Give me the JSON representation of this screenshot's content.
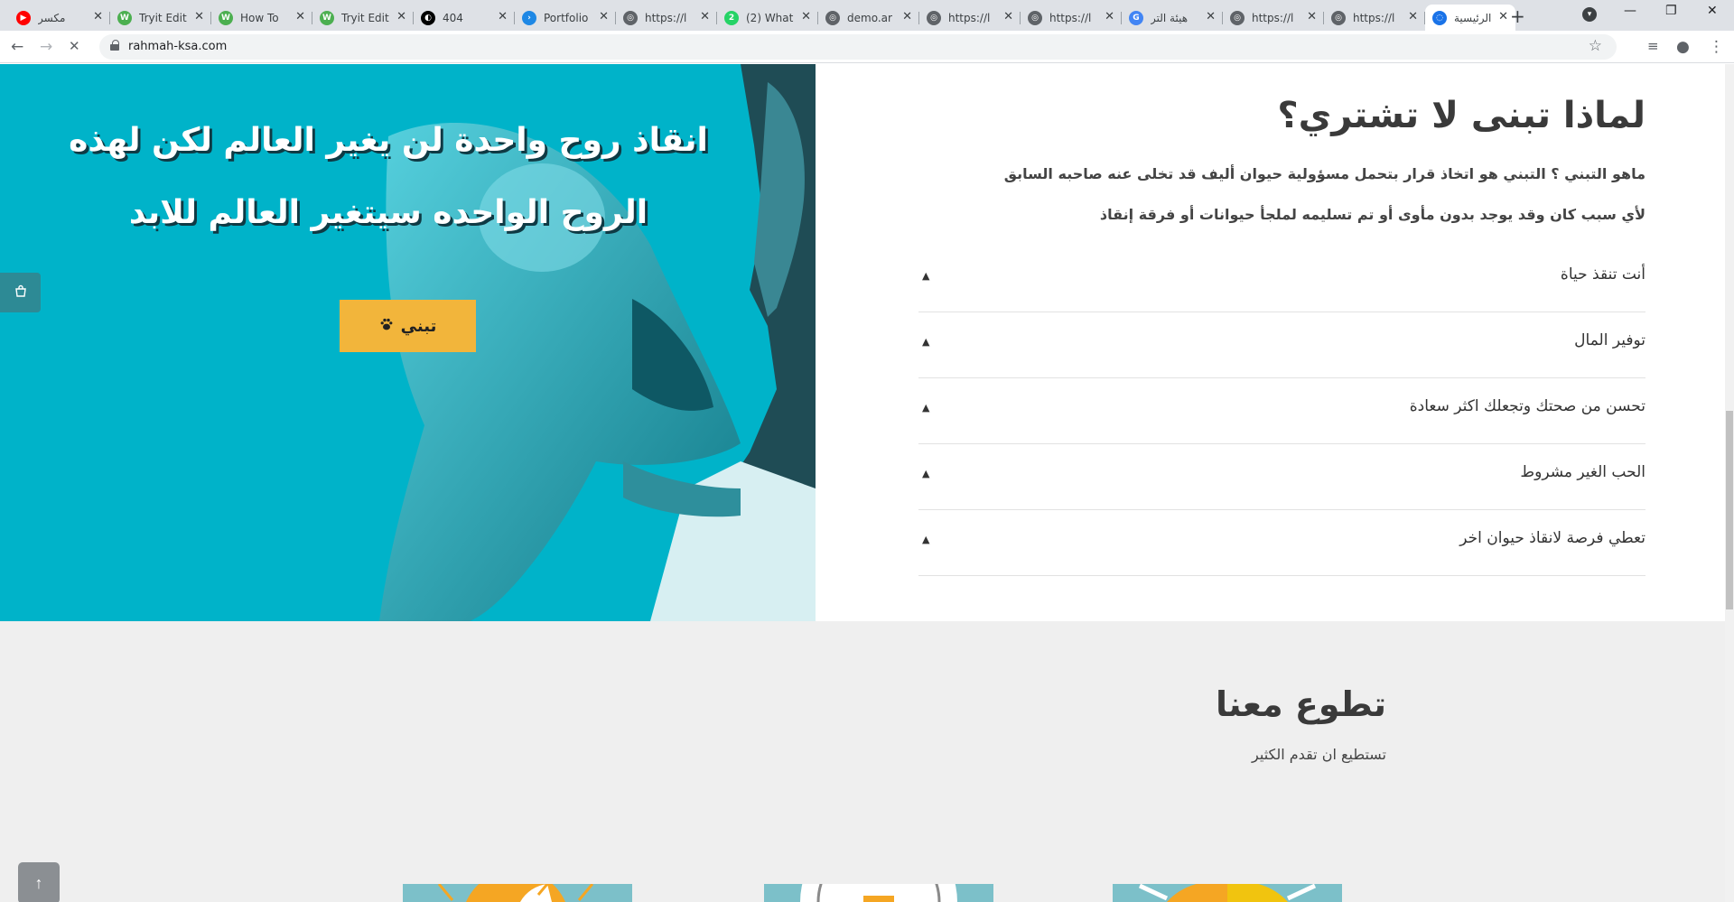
{
  "browser": {
    "tabs": [
      {
        "title": "مكسر",
        "fav_color": "#ff0000",
        "fav_glyph": "▶"
      },
      {
        "title": "Tryit Edit",
        "fav_color": "#4caf50",
        "fav_glyph": "W"
      },
      {
        "title": "How To",
        "fav_color": "#4caf50",
        "fav_glyph": "W"
      },
      {
        "title": "Tryit Edit",
        "fav_color": "#4caf50",
        "fav_glyph": "W"
      },
      {
        "title": "404",
        "fav_color": "#000000",
        "fav_glyph": "◐"
      },
      {
        "title": "Portfolio",
        "fav_color": "#1e88e5",
        "fav_glyph": "›"
      },
      {
        "title": "https://l",
        "fav_color": "#5f6368",
        "fav_glyph": "◎"
      },
      {
        "title": "(2) What",
        "fav_color": "#25d366",
        "fav_glyph": "2"
      },
      {
        "title": "demo.ar",
        "fav_color": "#5f6368",
        "fav_glyph": "◎"
      },
      {
        "title": "https://l",
        "fav_color": "#5f6368",
        "fav_glyph": "◎"
      },
      {
        "title": "https://l",
        "fav_color": "#5f6368",
        "fav_glyph": "◎"
      },
      {
        "title": "هيئة التر",
        "fav_color": "#4285f4",
        "fav_glyph": "G"
      },
      {
        "title": "https://l",
        "fav_color": "#5f6368",
        "fav_glyph": "◎"
      },
      {
        "title": "https://l",
        "fav_color": "#5f6368",
        "fav_glyph": "◎"
      },
      {
        "title": "الرئيسية",
        "fav_color": "#1a73e8",
        "fav_glyph": "◌"
      }
    ],
    "url": "rahmah-ksa.com"
  },
  "hero": {
    "line1": "انقاذ روح واحدة لن يغير العالم لكن لهذه",
    "line2": "الروح الواحده سيتغير العالم للابد",
    "button_label": "تبني",
    "colors": {
      "bg": "#00b3c9",
      "button": "#f2b53b"
    }
  },
  "faq": {
    "title": "لماذا تبنى لا تشتري؟",
    "intro1": "ماهو التبني ؟ التبني هو اتخاذ قرار بتحمل مسؤولية حيوان أليف قد تخلى عنه صاحبه السابق",
    "intro2": "لأي سبب كان وقد يوجد بدون مأوى أو تم تسليمه لملجأ حيوانات أو فرقة إنقاذ",
    "items": [
      {
        "label": "أنت تنقذ حياة"
      },
      {
        "label": "توفير المال"
      },
      {
        "label": "تحسن من صحتك وتجعلك اكثر سعادة"
      },
      {
        "label": "الحب الغير مشروط"
      },
      {
        "label": "تعطي فرصة لانقاذ حيوان اخر"
      }
    ]
  },
  "volunteer": {
    "title": "تطوع معنا",
    "subtitle": "تستطيع ان تقدم الكثير"
  }
}
